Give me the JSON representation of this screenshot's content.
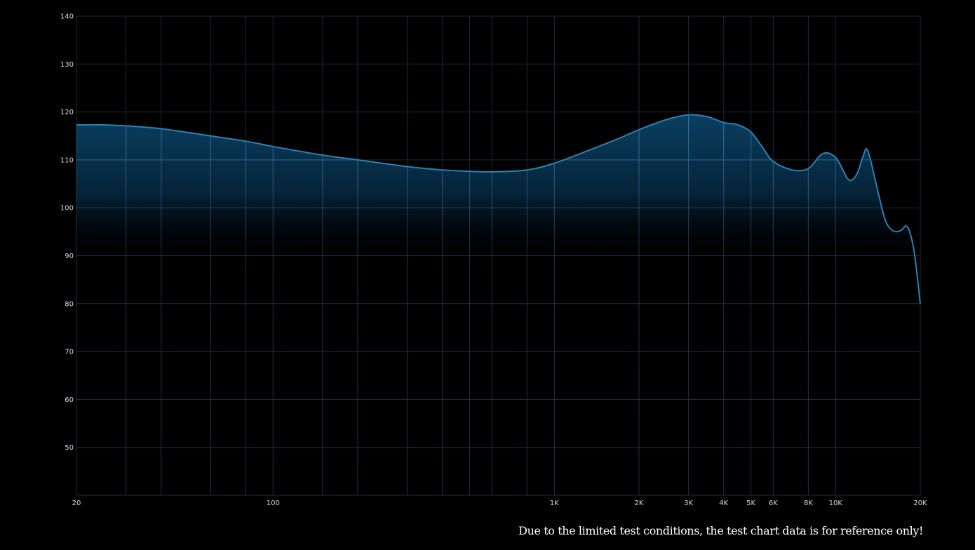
{
  "chart_data": {
    "type": "area",
    "xscale": "log",
    "xlim": [
      20,
      20000
    ],
    "ylim": [
      40,
      140
    ],
    "grid": true,
    "x_ticks": [
      {
        "value": 20,
        "label": "20"
      },
      {
        "value": 100,
        "label": "100"
      },
      {
        "value": 1000,
        "label": "1K"
      },
      {
        "value": 2000,
        "label": "2K"
      },
      {
        "value": 3000,
        "label": "3K"
      },
      {
        "value": 4000,
        "label": "4K"
      },
      {
        "value": 5000,
        "label": "5K"
      },
      {
        "value": 6000,
        "label": "6K"
      },
      {
        "value": 8000,
        "label": "8K"
      },
      {
        "value": 10000,
        "label": "10K"
      },
      {
        "value": 20000,
        "label": "20K"
      }
    ],
    "y_ticks": [
      {
        "value": 140,
        "label": "140"
      },
      {
        "value": 130,
        "label": "130"
      },
      {
        "value": 120,
        "label": "120"
      },
      {
        "value": 110,
        "label": "110"
      },
      {
        "value": 100,
        "label": "100"
      },
      {
        "value": 90,
        "label": "90"
      },
      {
        "value": 80,
        "label": "80"
      },
      {
        "value": 70,
        "label": "70"
      },
      {
        "value": 60,
        "label": "60"
      },
      {
        "value": 50,
        "label": "50"
      }
    ],
    "x_gridlines": [
      20,
      30,
      40,
      60,
      80,
      100,
      150,
      200,
      300,
      400,
      500,
      600,
      800,
      1000,
      2000,
      3000,
      4000,
      5000,
      6000,
      8000,
      10000,
      20000
    ],
    "y_gridlines": [
      140,
      130,
      120,
      110,
      100,
      90,
      80,
      70,
      60,
      50,
      40
    ],
    "series": [
      {
        "x": [
          20,
          25,
          30,
          40,
          60,
          80,
          100,
          150,
          200,
          300,
          400,
          500,
          600,
          800,
          1000,
          1300,
          1700,
          2000,
          2500,
          3000,
          3500,
          4000,
          4500,
          5000,
          5500,
          6000,
          7000,
          8000,
          9000,
          10000,
          11000,
          11500,
          12000,
          12500,
          13000,
          14000,
          15000,
          16000,
          17000,
          18000,
          19000,
          20000
        ],
        "y": [
          117.3,
          117.3,
          117.1,
          116.5,
          115.0,
          113.9,
          112.8,
          111.0,
          110.0,
          108.6,
          107.9,
          107.6,
          107.5,
          107.9,
          109.3,
          111.8,
          114.5,
          116.3,
          118.4,
          119.4,
          119.0,
          117.8,
          117.3,
          115.8,
          112.6,
          109.7,
          107.9,
          108.2,
          111.3,
          110.5,
          106.2,
          105.9,
          107.5,
          110.6,
          112.0,
          104.5,
          97.5,
          95.2,
          95.2,
          96.0,
          91.0,
          80.0
        ]
      }
    ],
    "colors": {
      "line": "#2f7fb2",
      "fill": "#0b4468",
      "grid": "#1c2833",
      "major_grid": "#3d76a2",
      "labels": "#d8d8d8"
    }
  },
  "disclaimer": "Due to the limited test conditions, the test chart data is for reference only!"
}
